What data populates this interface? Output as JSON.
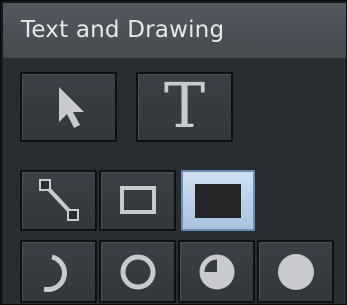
{
  "panel": {
    "title": "Text and Drawing"
  },
  "tools": {
    "row1": [
      {
        "name": "select",
        "icon": "arrow-pointer-icon",
        "selected": false
      },
      {
        "name": "text",
        "icon": "text-icon",
        "glyph": "T",
        "selected": false
      }
    ],
    "row2": [
      {
        "name": "line",
        "icon": "line-icon",
        "selected": false
      },
      {
        "name": "rectangle",
        "icon": "rectangle-outline-icon",
        "selected": false
      },
      {
        "name": "filled-rectangle",
        "icon": "rectangle-filled-icon",
        "selected": true
      }
    ],
    "row3": [
      {
        "name": "arc",
        "icon": "arc-icon",
        "selected": false
      },
      {
        "name": "circle",
        "icon": "circle-outline-icon",
        "selected": false
      },
      {
        "name": "pie",
        "icon": "pie-icon",
        "selected": false
      },
      {
        "name": "filled-circle",
        "icon": "circle-filled-icon",
        "selected": false
      }
    ]
  },
  "colors": {
    "header_bg": "#4d5258",
    "panel_bg": "#2a2d30",
    "button_bg": "#383c41",
    "icon": "#c8cacd",
    "selected_bg": "#bcd2ea",
    "selected_border": "#6c8eb4"
  }
}
